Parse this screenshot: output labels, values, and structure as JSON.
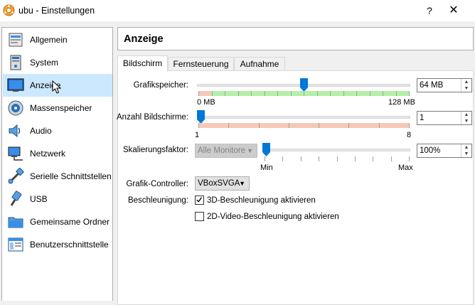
{
  "window": {
    "title": "ubu - Einstellungen",
    "help_label": "?",
    "close_label": "✕"
  },
  "sidebar": {
    "items": [
      {
        "label": "Allgemein",
        "icon": "general-icon"
      },
      {
        "label": "System",
        "icon": "system-icon"
      },
      {
        "label": "Anzeige",
        "icon": "display-icon",
        "selected": true
      },
      {
        "label": "Massenspeicher",
        "icon": "storage-icon"
      },
      {
        "label": "Audio",
        "icon": "audio-icon"
      },
      {
        "label": "Netzwerk",
        "icon": "network-icon"
      },
      {
        "label": "Serielle Schnittstellen",
        "icon": "serial-ports-icon"
      },
      {
        "label": "USB",
        "icon": "usb-icon"
      },
      {
        "label": "Gemeinsame Ordner",
        "icon": "shared-folders-icon"
      },
      {
        "label": "Benutzerschnittstelle",
        "icon": "user-interface-icon"
      }
    ]
  },
  "page": {
    "title": "Anzeige",
    "tabs": [
      {
        "label": "Bildschirm",
        "active": true
      },
      {
        "label": "Fernsteuerung"
      },
      {
        "label": "Aufnahme"
      }
    ]
  },
  "screen_tab": {
    "video_memory": {
      "label": "Grafikspeicher:",
      "value": "64 MB",
      "min_label": "0 MB",
      "max_label": "128 MB",
      "level": 0.5
    },
    "monitor_count": {
      "label": "Anzahl Bildschirme:",
      "value": "1",
      "min_label": "1",
      "max_label": "8",
      "level": 0
    },
    "scale_factor": {
      "label": "Skalierungsfaktor:",
      "monitor_select": "Alle Monitore",
      "value": "100%",
      "min_label": "Min",
      "max_label": "Max",
      "level": 0
    },
    "graphics_controller": {
      "label": "Grafik-Controller:",
      "value": "VBoxSVGA"
    },
    "acceleration": {
      "label": "Beschleunigung:",
      "accel_3d": {
        "label": "3D-Beschleunigung aktivieren",
        "checked": true
      },
      "accel_2d": {
        "label": "2D-Video-Beschleunigung aktivieren",
        "checked": false
      }
    }
  },
  "colors": {
    "selection": "#cce8ff",
    "slider_thumb": "#0078d7",
    "range_green": "#b4f0a8",
    "range_red": "#f6c9b6"
  }
}
